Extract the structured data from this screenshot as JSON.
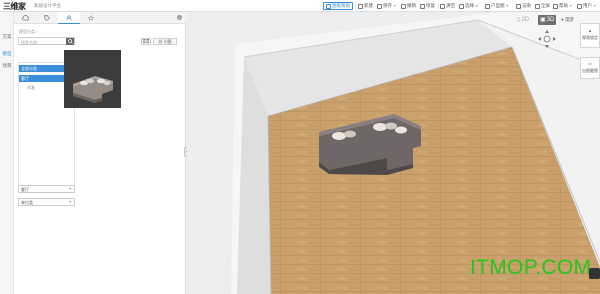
{
  "app": {
    "logo_text": "三维家",
    "subtitle": "家居设计平台"
  },
  "toolbar": {
    "items": [
      {
        "label": "图纸帮助",
        "icon": "doc-icon",
        "active": true
      },
      {
        "label": "新建",
        "icon": "file-icon"
      },
      {
        "label": "保存",
        "icon": "save-icon",
        "has_menu": true
      },
      {
        "label": "撤销",
        "icon": "undo-icon"
      },
      {
        "label": "恢复",
        "icon": "redo-icon"
      },
      {
        "label": "清空",
        "icon": "clear-icon"
      },
      {
        "label": "选择",
        "icon": "select-icon",
        "has_menu": true
      },
      {
        "label": "户型图",
        "icon": "floorplan-icon",
        "has_menu": true
      },
      {
        "label": "渲染",
        "icon": "render-icon"
      },
      {
        "label": "全屏",
        "icon": "fullscreen-icon"
      },
      {
        "label": "帮助",
        "icon": "help-icon",
        "has_menu": true
      },
      {
        "label": "用户",
        "icon": "user-icon",
        "has_menu": true
      }
    ]
  },
  "rail": {
    "items": [
      {
        "label": "方案"
      },
      {
        "label": "模型",
        "active": true
      },
      {
        "label": "场景"
      }
    ]
  },
  "panel": {
    "tabs": [
      {
        "icon": "cloud-icon"
      },
      {
        "icon": "tag-icon"
      },
      {
        "icon": "user-icon",
        "active": true
      },
      {
        "icon": "star-icon"
      }
    ],
    "breadcrumb": "模型分类 >",
    "search_placeholder": "搜索名称",
    "view_list": "列表",
    "view_grid": "小图",
    "categories": [
      {
        "label": "全部分类",
        "selected": true
      },
      {
        "label": "客厅",
        "selected": true
      },
      {
        "label": "沙发",
        "sub": true
      }
    ],
    "filter1": "客厅",
    "filter2": "单位类"
  },
  "viewport": {
    "mode_2d": "2D",
    "mode_3d": "3D",
    "mode_roam": "漫游",
    "side_top_label": "视角锁定",
    "side_bottom_label": "出图截图",
    "watermark": "ITMOP.COM",
    "colors": {
      "floor": "#c9a06a",
      "wall": "#f1f1f1",
      "sofa": "#6e6466",
      "accent": "#3a8fd8"
    }
  }
}
